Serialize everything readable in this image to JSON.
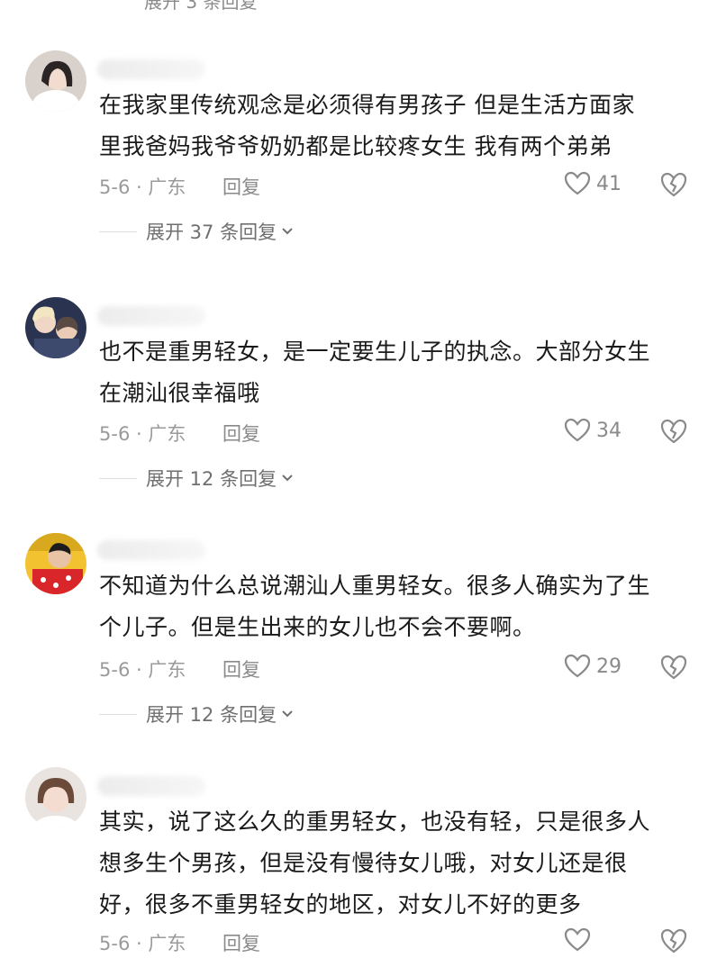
{
  "top_partial_text": "展开 3 条回复",
  "comments": [
    {
      "text_line1": "在我家里传统观念是必须得有男孩子 但是生活方面家",
      "text_line2": "里我爸妈我爷爷奶奶都是比较疼女生  我有两个弟弟",
      "date_location": "5-6 · 广东",
      "reply_label": "回复",
      "likes": "41",
      "expand_label": "展开 37 条回复"
    },
    {
      "text_line1": "也不是重男轻女，是一定要生儿子的执念。大部分女生",
      "text_line2": "在潮汕很幸福哦",
      "date_location": "5-6 · 广东",
      "reply_label": "回复",
      "likes": "34",
      "expand_label": "展开 12 条回复"
    },
    {
      "text_line1": "不知道为什么总说潮汕人重男轻女。很多人确实为了生",
      "text_line2": "个儿子。但是生出来的女儿也不会不要啊。",
      "date_location": "5-6 · 广东",
      "reply_label": "回复",
      "likes": "29",
      "expand_label": "展开 12 条回复"
    },
    {
      "text_line1": "其实，说了这么久的重男轻女，也没有轻，只是很多人",
      "text_line2": "想多生个男孩，但是没有慢待女儿哦，对女儿还是很",
      "text_line3": "好，很多不重男轻女的地区，对女儿不好的更多",
      "date_location": "5-6 · 广东",
      "reply_label": "回复"
    }
  ],
  "colors": {
    "text": "#1a1a1a",
    "meta": "#9a9a9a",
    "icon": "#8a8a8a"
  }
}
